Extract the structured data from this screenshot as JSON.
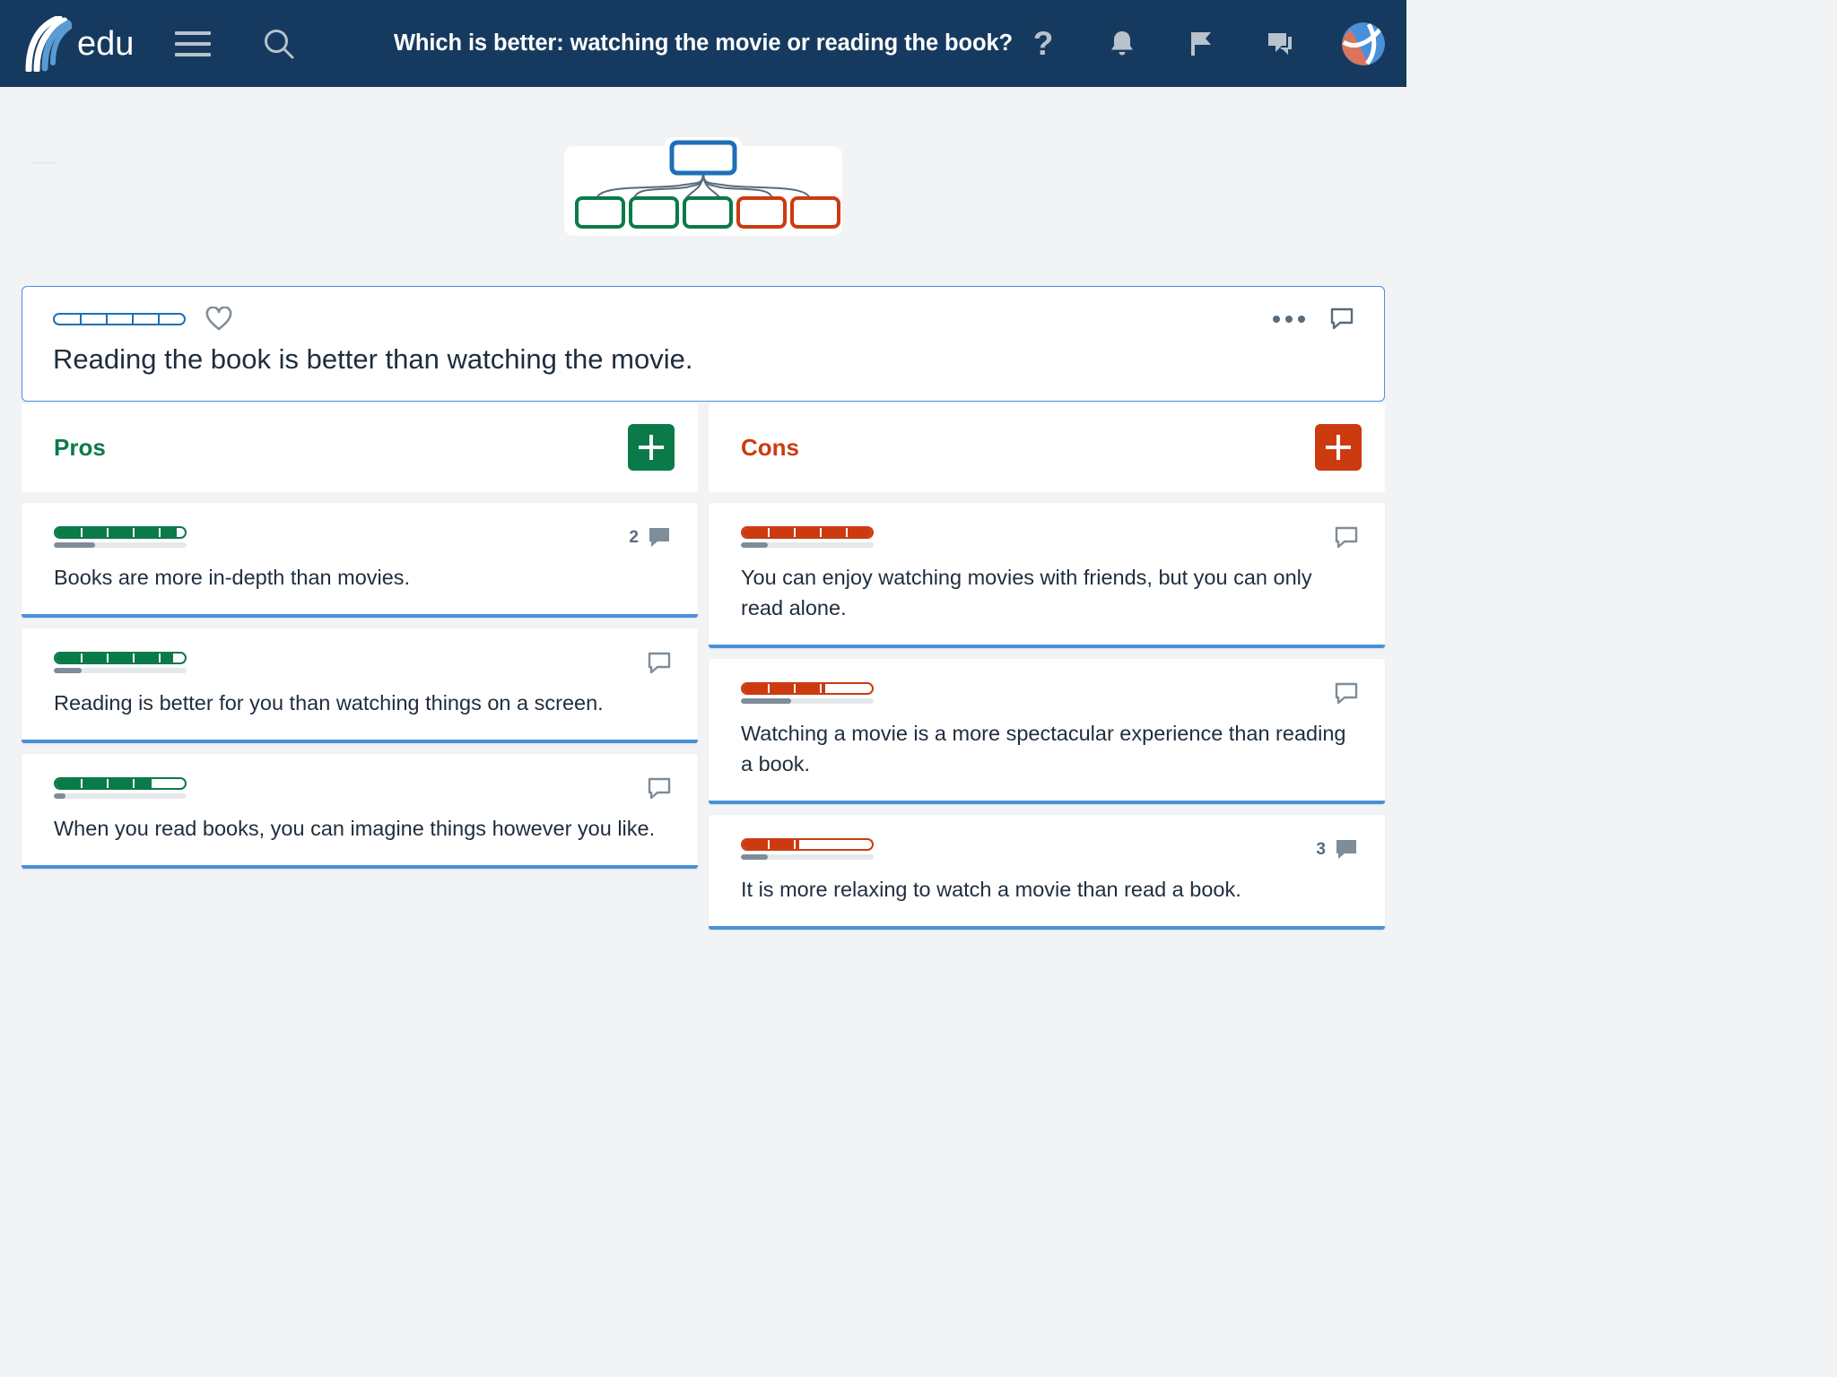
{
  "header": {
    "brand_text": "edu",
    "logo_icon": "kialo-waves-logo",
    "menu_icon": "hamburger-menu-icon",
    "search_icon": "search-icon",
    "title": "Which is better: watching the movie or reading the book?",
    "help_icon": "question-mark-icon",
    "help_glyph": "?",
    "notifications_icon": "bell-icon",
    "flags_icon": "flag-icon",
    "messages_icon": "chat-bubble-icon",
    "avatar_icon": "user-avatar",
    "background_color": "#163a5f"
  },
  "treemap": {
    "name": "argument-tree-minimap",
    "root": {
      "color": "#1d6fb8"
    },
    "children": [
      {
        "type": "pro",
        "color": "#0b7a49"
      },
      {
        "type": "pro",
        "color": "#0b7a49"
      },
      {
        "type": "pro",
        "color": "#0b7a49"
      },
      {
        "type": "con",
        "color": "#cc3b10"
      },
      {
        "type": "con",
        "color": "#cc3b10"
      },
      {
        "type": "con",
        "color": "#cc3b10"
      }
    ]
  },
  "claim": {
    "text": "Reading the book is better than watching the movie.",
    "rating": {
      "value": 0,
      "max": 5,
      "segments": 5,
      "color": "#1d6fb8"
    },
    "like_icon": "heart-icon",
    "more_icon": "ellipsis-icon",
    "comment_icon": "comment-outline-icon",
    "border_color": "#4a90d9"
  },
  "columns": {
    "pros": {
      "label": "Pros",
      "color": "#0b7a49",
      "add_icon": "plus-icon",
      "items": [
        {
          "text": "Books are more in-depth than movies.",
          "rating": {
            "value": 4.7,
            "max": 5,
            "segments": 5
          },
          "support": 0.31,
          "comment_count": "2",
          "comment_icon": "comment-filled-icon"
        },
        {
          "text": "Reading is better for you than watching things on a screen.",
          "rating": {
            "value": 4.6,
            "max": 5,
            "segments": 5
          },
          "support": 0.21,
          "comment_count": "",
          "comment_icon": "comment-outline-icon"
        },
        {
          "text": "When you read books, you can imagine things however you like.",
          "rating": {
            "value": 3.8,
            "max": 5,
            "segments": 5
          },
          "support": 0.09,
          "comment_count": "",
          "comment_icon": "comment-outline-icon"
        }
      ]
    },
    "cons": {
      "label": "Cons",
      "color": "#cc3b10",
      "add_icon": "plus-icon",
      "items": [
        {
          "text": "You can enjoy watching movies with friends, but you can only read alone.",
          "rating": {
            "value": 5.0,
            "max": 5,
            "segments": 5
          },
          "support": 0.2,
          "comment_count": "",
          "comment_icon": "comment-outline-icon"
        },
        {
          "text": "Watching a movie is a more spectacular experience than reading a book.",
          "rating": {
            "value": 3.3,
            "max": 5,
            "segments": 5
          },
          "support": 0.38,
          "comment_count": "",
          "comment_icon": "comment-outline-icon"
        },
        {
          "text": "It is more relaxing to watch a movie than read a book.",
          "rating": {
            "value": 2.3,
            "max": 5,
            "segments": 5
          },
          "support": 0.2,
          "comment_count": "3",
          "comment_icon": "comment-filled-icon"
        }
      ]
    }
  }
}
